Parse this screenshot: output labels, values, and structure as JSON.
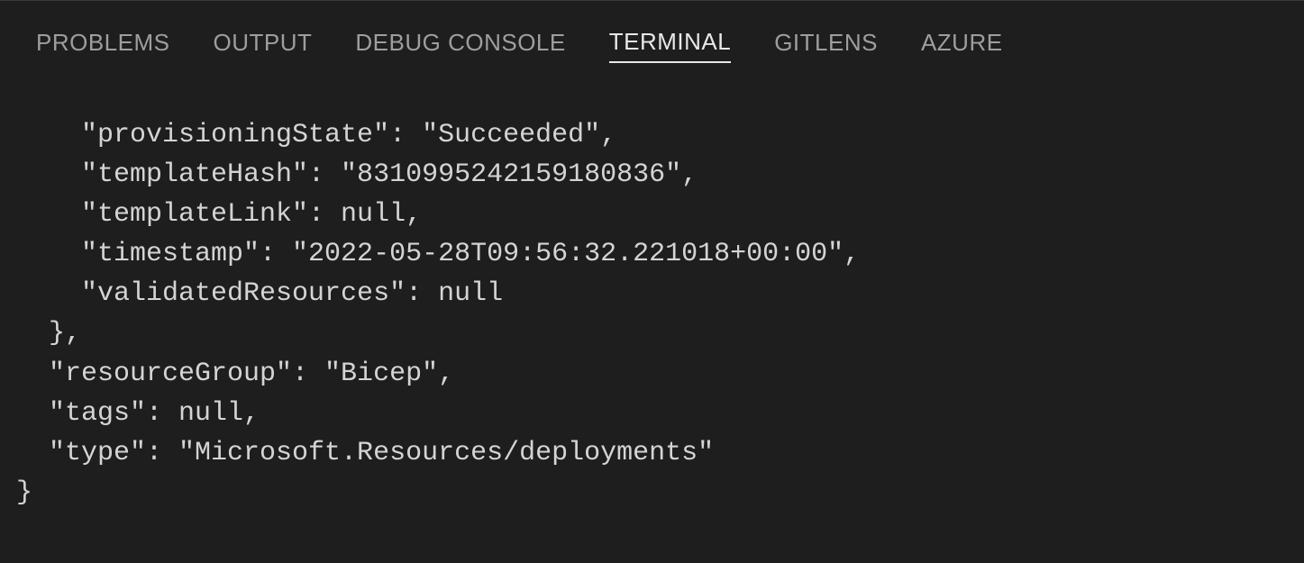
{
  "tabs": [
    {
      "label": "PROBLEMS",
      "active": false
    },
    {
      "label": "OUTPUT",
      "active": false
    },
    {
      "label": "DEBUG CONSOLE",
      "active": false
    },
    {
      "label": "TERMINAL",
      "active": true
    },
    {
      "label": "GITLENS",
      "active": false
    },
    {
      "label": "AZURE",
      "active": false
    }
  ],
  "terminal_output": {
    "lines": [
      "    \"provisioningState\": \"Succeeded\",",
      "    \"templateHash\": \"8310995242159180836\",",
      "    \"templateLink\": null,",
      "    \"timestamp\": \"2022-05-28T09:56:32.221018+00:00\",",
      "    \"validatedResources\": null",
      "  },",
      "  \"resourceGroup\": \"Bicep\",",
      "  \"tags\": null,",
      "  \"type\": \"Microsoft.Resources/deployments\"",
      "}"
    ]
  }
}
